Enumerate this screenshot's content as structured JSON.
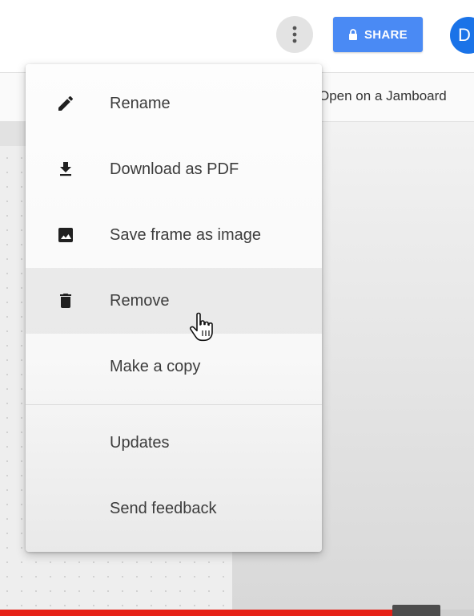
{
  "topbar": {
    "more_icon": "more-vert-icon",
    "share_label": "SHARE",
    "share_icon": "lock-icon",
    "avatar_initial": "D",
    "colors": {
      "share": "#4a8af4",
      "avatar": "#1a73e8"
    }
  },
  "subbar": {
    "open_label": "Open on a Jamboard"
  },
  "menu": {
    "items": [
      {
        "label": "Rename",
        "icon": "pencil-icon"
      },
      {
        "label": "Download as PDF",
        "icon": "download-icon"
      },
      {
        "label": "Save frame as image",
        "icon": "image-icon"
      },
      {
        "label": "Remove",
        "icon": "trash-icon",
        "hovered": true
      },
      {
        "label": "Make a copy",
        "icon": ""
      },
      {
        "label": "Updates",
        "icon": ""
      },
      {
        "label": "Send feedback",
        "icon": ""
      }
    ]
  },
  "video": {
    "progress_percent": 84,
    "progress_color": "#e62117"
  }
}
